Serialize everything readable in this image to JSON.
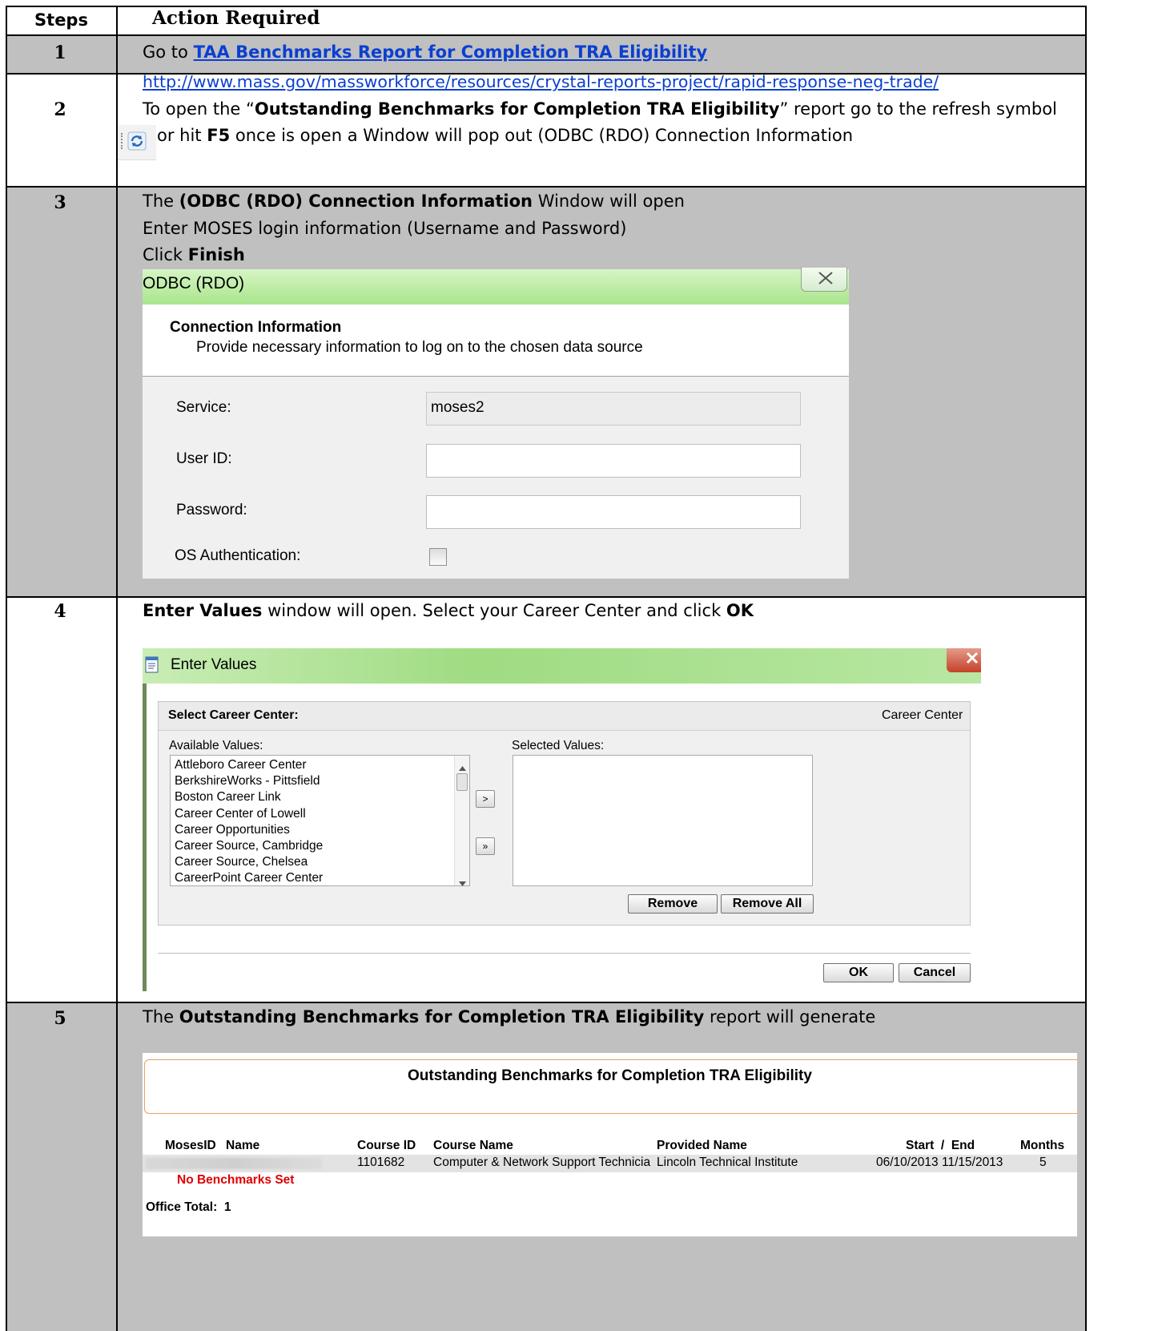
{
  "table": {
    "header_steps": "Steps",
    "header_action": "Action Required"
  },
  "step1": {
    "num": "1",
    "go_to": "Go to ",
    "link_text": "TAA Benchmarks Report for Completion TRA Eligibility",
    "url": "http://www.mass.gov/massworkforce/resources/crystal-reports-project/rapid-response-neg-trade/"
  },
  "step2": {
    "num": "2",
    "t1": "To open the “",
    "t1b": "Outstanding Benchmarks for Completion TRA Eligibility",
    "t1c": "” report go to the refresh symbol",
    "t2": " or hit ",
    "t2b": "F5",
    "t2c": " once is open a Window will pop out (ODBC (RDO) Connection Information"
  },
  "step3": {
    "num": "3",
    "l1a": "The ",
    "l1b": "(ODBC (RDO) Connection Information",
    "l1c": " Window will open",
    "l2": "Enter MOSES login information (Username and Password)",
    "l3a": "Click ",
    "l3b": "Finish",
    "dialog": {
      "title": "ODBC (RDO)",
      "heading": "Connection Information",
      "subheading": "Provide necessary information to log on to the chosen data source",
      "service_label": "Service:",
      "service_value": "moses2",
      "userid_label": "User ID:",
      "userid_value": "",
      "password_label": "Password:",
      "password_value": "",
      "os_auth_label": "OS Authentication:"
    }
  },
  "step4": {
    "num": "4",
    "t1": "Enter Values",
    "t2": " window will open.  Select your Career Center and click ",
    "t3": "OK",
    "dialog": {
      "title": "Enter Values",
      "select_label": "Select Career Center:",
      "right_label": "Career Center",
      "available_label": "Available Values:",
      "selected_label": "Selected Values:",
      "available_values": [
        "Attleboro Career Center",
        "BerkshireWorks - Pittsfield",
        "Boston Career Link",
        "Career Center of Lowell",
        "Career Opportunities",
        "Career Source, Cambridge",
        "Career Source, Chelsea",
        "CareerPoint Career Center"
      ],
      "add_label": ">",
      "add_all_label": "»",
      "remove_label": "Remove",
      "remove_all_label": "Remove All",
      "ok_label": "OK",
      "cancel_label": "Cancel"
    }
  },
  "step5": {
    "num": "5",
    "t1": "The ",
    "t2": "Outstanding Benchmarks for Completion TRA Eligibility",
    "t3": " report will generate",
    "report": {
      "title": "Outstanding Benchmarks for Completion TRA Eligibility",
      "col_mosesid": "MosesID",
      "col_name": "Name",
      "col_course_id": "Course ID",
      "col_course_name": "Course Name",
      "col_provided_name": "Provided Name",
      "col_start_end": "Start  /  End",
      "col_months": "Months",
      "row": {
        "course_id": "1101682",
        "course_name": "Computer & Network Support Technicia",
        "provided_name": "Lincoln Technical Institute",
        "start": "06/10/2013",
        "end": "11/15/2013",
        "months": "5"
      },
      "no_benchmarks": "No Benchmarks Set",
      "office_total": "Office Total:  1"
    }
  }
}
